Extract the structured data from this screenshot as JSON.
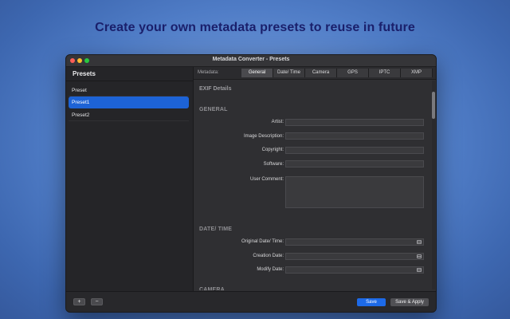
{
  "headline": "Create your own metadata presets to reuse in future",
  "window": {
    "title": "Metadata Converter - Presets"
  },
  "sidebar": {
    "title": "Presets",
    "items": [
      {
        "label": "Preset",
        "selected": false
      },
      {
        "label": "Preset1",
        "selected": true
      },
      {
        "label": "Preset2",
        "selected": false
      }
    ]
  },
  "tabbar": {
    "label": "Metadata:",
    "tabs": [
      {
        "label": "General",
        "active": true
      },
      {
        "label": "Date/ Time",
        "active": false
      },
      {
        "label": "Camera",
        "active": false
      },
      {
        "label": "GPS",
        "active": false
      },
      {
        "label": "IPTC",
        "active": false
      },
      {
        "label": "XMP",
        "active": false
      }
    ]
  },
  "content": {
    "heading": "EXIF Details",
    "general": {
      "title": "GENERAL",
      "fields": [
        {
          "label": "Artist:",
          "value": ""
        },
        {
          "label": "Image Description:",
          "value": ""
        },
        {
          "label": "Copyright:",
          "value": ""
        },
        {
          "label": "Software:",
          "value": ""
        },
        {
          "label": "User Comment:",
          "value": ""
        }
      ]
    },
    "datetime": {
      "title": "DATE/ TIME",
      "fields": [
        {
          "label": "Original Date/ Time:",
          "value": ""
        },
        {
          "label": "Creation Date:",
          "value": ""
        },
        {
          "label": "Modify Date:",
          "value": ""
        }
      ]
    },
    "next_section_title": "CAMERA"
  },
  "footer": {
    "add_label": "+",
    "remove_label": "−",
    "save_label": "Save",
    "save_apply_label": "Save & Apply"
  },
  "colors": {
    "accent": "#1d6ae8",
    "selection": "#1d63d6",
    "headline": "#1a1f6b"
  }
}
